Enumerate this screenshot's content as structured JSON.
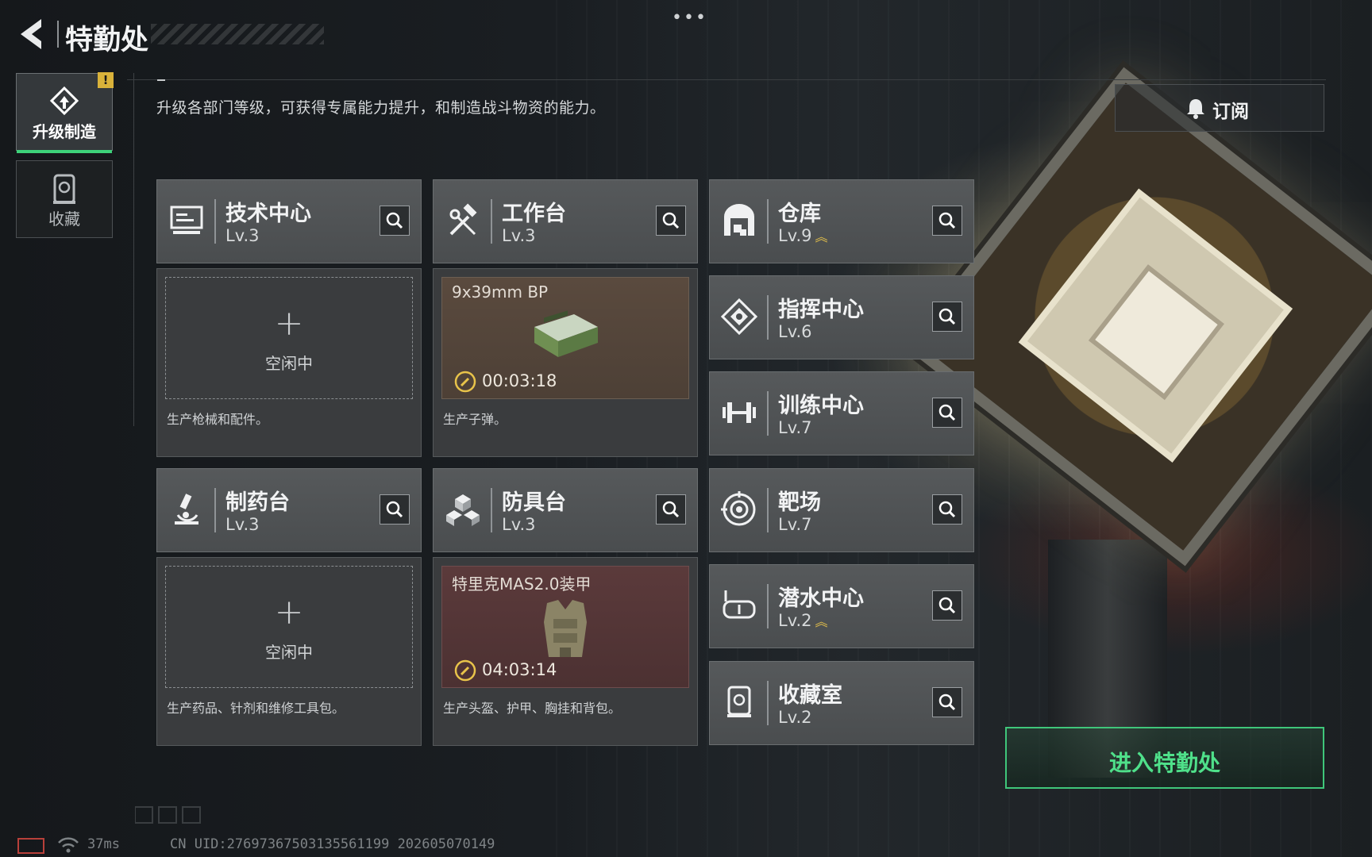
{
  "header": {
    "title": "特勤处",
    "back_icon": "back-arrow-icon"
  },
  "nav": {
    "items": [
      {
        "label": "升级制造",
        "icon": "upgrade-icon",
        "active": true,
        "alert": "!"
      },
      {
        "label": "收藏",
        "icon": "collection-icon",
        "active": false
      }
    ]
  },
  "description": "升级各部门等级，可获得专属能力提升，和制造战斗物资的能力。",
  "subscribe": {
    "label": "订阅",
    "icon": "bell-icon"
  },
  "departments": [
    {
      "name": "技术中心",
      "level": "Lv.3",
      "icon": "computer-icon",
      "slot": {
        "state": "idle",
        "plus": "+",
        "label": "空闲中"
      },
      "caption": "生产枪械和配件。"
    },
    {
      "name": "工作台",
      "level": "Lv.3",
      "icon": "tools-icon",
      "slot": {
        "state": "producing",
        "item": "9x39mm BP",
        "timer": "00:03:18"
      },
      "caption": "生产子弹。"
    },
    {
      "name": "制药台",
      "level": "Lv.3",
      "icon": "microscope-icon",
      "slot": {
        "state": "idle",
        "plus": "+",
        "label": "空闲中"
      },
      "caption": "生产药品、针剂和维修工具包。"
    },
    {
      "name": "防具台",
      "level": "Lv.3",
      "icon": "cubes-icon",
      "slot": {
        "state": "producing",
        "item": "特里克MAS2.0装甲",
        "timer": "04:03:14"
      },
      "caption": "生产头盔、护甲、胸挂和背包。"
    }
  ],
  "facilities": [
    {
      "name": "仓库",
      "level": "Lv.9",
      "icon": "warehouse-icon",
      "upgradable": true
    },
    {
      "name": "指挥中心",
      "level": "Lv.6",
      "icon": "command-icon",
      "upgradable": false
    },
    {
      "name": "训练中心",
      "level": "Lv.7",
      "icon": "dumbbell-icon",
      "upgradable": false
    },
    {
      "name": "靶场",
      "level": "Lv.7",
      "icon": "target-icon",
      "upgradable": false
    },
    {
      "name": "潜水中心",
      "level": "Lv.2",
      "icon": "diving-mask-icon",
      "upgradable": true
    },
    {
      "name": "收藏室",
      "level": "Lv.2",
      "icon": "collection-room-icon",
      "upgradable": false
    }
  ],
  "enter_button": {
    "label": "进入特勤处"
  },
  "footer": {
    "ping": "37ms",
    "uid": "CN UID:276973675031355611​99 202605070149"
  },
  "top_menu": "•••",
  "colors": {
    "accent": "#3fc67a",
    "upgrade_arrow": "#e8c34a",
    "alert": "#d9b23a"
  }
}
